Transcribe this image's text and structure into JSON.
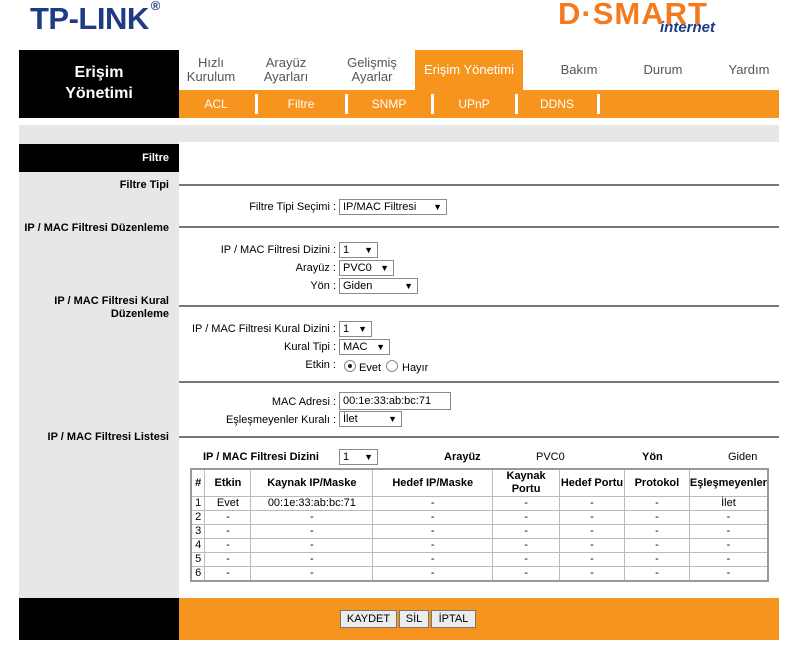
{
  "header": {
    "tplink_logo": "TP-LINK",
    "tplink_reg": "®",
    "dsmart_logo": "D·SMART",
    "dsmart_sub": "internet"
  },
  "nav": {
    "brand_line1": "Erişim",
    "brand_line2": "Yönetimi",
    "menu": [
      {
        "line1": "Hızlı",
        "line2": "Kurulum"
      },
      {
        "line1": "Arayüz",
        "line2": "Ayarları"
      },
      {
        "line1": "Gelişmiş",
        "line2": "Ayarlar"
      },
      {
        "line1": "Erişim Yönetimi",
        "line2": ""
      },
      {
        "line1": "Bakım",
        "line2": ""
      },
      {
        "line1": "Durum",
        "line2": ""
      },
      {
        "line1": "Yardım",
        "line2": ""
      }
    ],
    "submenu": [
      "ACL",
      "Filtre",
      "SNMP",
      "UPnP",
      "DDNS"
    ]
  },
  "page": {
    "title": "Filtre",
    "sections": {
      "filter_type": "Filtre Tipi",
      "ipmac_edit": "IP / MAC Filtresi Düzenleme",
      "ipmac_rule_edit": "IP / MAC Filtresi Kural Düzenleme",
      "ipmac_list": "IP / MAC Filtresi Listesi"
    },
    "filter_type_select": {
      "label": "Filtre Tipi Seçimi :",
      "value": "IP/MAC Filtresi"
    },
    "ipmac_index": {
      "label": "IP / MAC Filtresi Dizini :",
      "value": "1"
    },
    "interface": {
      "label": "Arayüz :",
      "value": "PVC0"
    },
    "direction": {
      "label": "Yön :",
      "value": "Giden"
    },
    "rule_index": {
      "label": "IP / MAC Filtresi Kural Dizini :",
      "value": "1"
    },
    "rule_type": {
      "label": "Kural Tipi :",
      "value": "MAC"
    },
    "active": {
      "label": "Etkin :",
      "yes": "Evet",
      "no": "Hayır"
    },
    "mac_address": {
      "label": "MAC Adresi :",
      "value": "00:1e:33:ab:bc:71"
    },
    "unmatched_rule": {
      "label": "Eşleşmeyenler Kuralı :",
      "value": "İlet"
    }
  },
  "list": {
    "index_label": "IP / MAC Filtresi Dizini",
    "index_value": "1",
    "interface_label": "Arayüz",
    "interface_value": "PVC0",
    "direction_label": "Yön",
    "direction_value": "Giden",
    "columns": [
      "#",
      "Etkin",
      "Kaynak IP/Maske",
      "Hedef IP/Maske",
      "Kaynak Portu",
      "Hedef Portu",
      "Protokol",
      "Eşleşmeyenler"
    ],
    "rows": [
      [
        "1",
        "Evet",
        "00:1e:33:ab:bc:71",
        "-",
        "-",
        "-",
        "-",
        "İlet"
      ],
      [
        "2",
        "-",
        "-",
        "-",
        "-",
        "-",
        "-",
        "-"
      ],
      [
        "3",
        "-",
        "-",
        "-",
        "-",
        "-",
        "-",
        "-"
      ],
      [
        "4",
        "-",
        "-",
        "-",
        "-",
        "-",
        "-",
        "-"
      ],
      [
        "5",
        "-",
        "-",
        "-",
        "-",
        "-",
        "-",
        "-"
      ],
      [
        "6",
        "-",
        "-",
        "-",
        "-",
        "-",
        "-",
        "-"
      ]
    ]
  },
  "buttons": {
    "save": "KAYDET",
    "delete": "SİL",
    "cancel": "İPTAL"
  }
}
